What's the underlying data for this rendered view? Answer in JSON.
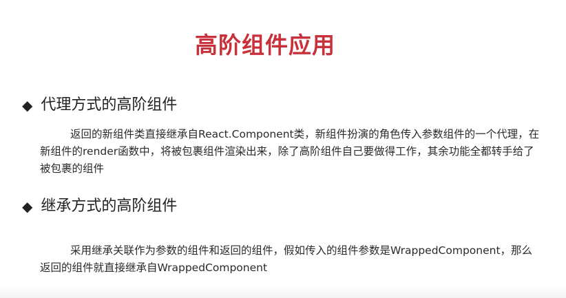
{
  "slide": {
    "title": "高阶组件应用",
    "title_color": "#c8303a",
    "bullet_glyph": "◆",
    "sections": [
      {
        "heading": "代理方式的高阶组件",
        "paragraph": "返回的新组件类直接继承自React.Component类，新组件扮演的角色传入参数组件的一个代理，在新组件的render函数中，将被包裹组件渲染出来，除了高阶组件自己要做得工作，其余功能全都转手给了被包裹的组件"
      },
      {
        "heading": "继承方式的高阶组件",
        "paragraph": "采用继承关联作为参数的组件和返回的组件，假如传入的组件参数是WrappedComponent，那么返回的组件就直接继承自WrappedComponent"
      }
    ]
  }
}
